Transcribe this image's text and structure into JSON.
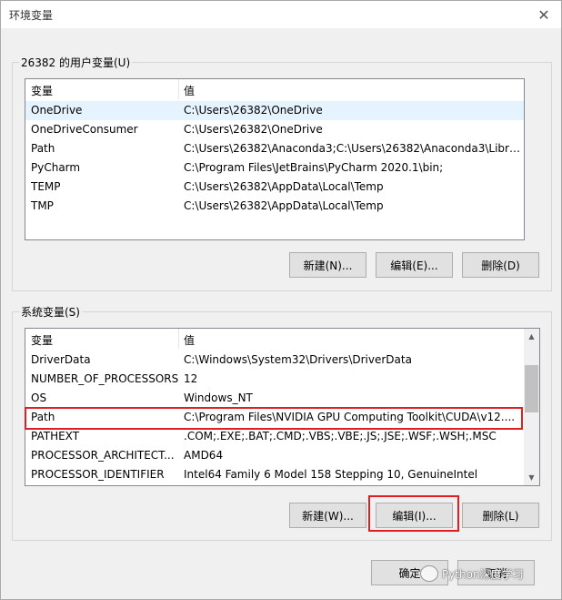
{
  "window": {
    "title": "环境变量",
    "close_glyph": "✕"
  },
  "user_vars": {
    "group_label": "26382 的用户变量(U)",
    "col_name": "变量",
    "col_value": "值",
    "rows": [
      {
        "name": "OneDrive",
        "value": "C:\\Users\\26382\\OneDrive"
      },
      {
        "name": "OneDriveConsumer",
        "value": "C:\\Users\\26382\\OneDrive"
      },
      {
        "name": "Path",
        "value": "C:\\Users\\26382\\Anaconda3;C:\\Users\\26382\\Anaconda3\\Libra..."
      },
      {
        "name": "PyCharm",
        "value": "C:\\Program Files\\JetBrains\\PyCharm 2020.1\\bin;"
      },
      {
        "name": "TEMP",
        "value": "C:\\Users\\26382\\AppData\\Local\\Temp"
      },
      {
        "name": "TMP",
        "value": "C:\\Users\\26382\\AppData\\Local\\Temp"
      }
    ],
    "buttons": {
      "new": "新建(N)...",
      "edit": "编辑(E)...",
      "delete": "删除(D)"
    }
  },
  "system_vars": {
    "group_label": "系统变量(S)",
    "col_name": "变量",
    "col_value": "值",
    "rows": [
      {
        "name": "DriverData",
        "value": "C:\\Windows\\System32\\Drivers\\DriverData"
      },
      {
        "name": "NUMBER_OF_PROCESSORS",
        "value": "12"
      },
      {
        "name": "OS",
        "value": "Windows_NT"
      },
      {
        "name": "Path",
        "value": "C:\\Program Files\\NVIDIA GPU Computing Toolkit\\CUDA\\v12...."
      },
      {
        "name": "PATHEXT",
        "value": ".COM;.EXE;.BAT;.CMD;.VBS;.VBE;.JS;.JSE;.WSF;.WSH;.MSC"
      },
      {
        "name": "PROCESSOR_ARCHITECT...",
        "value": "AMD64"
      },
      {
        "name": "PROCESSOR_IDENTIFIER",
        "value": "Intel64 Family 6 Model 158 Stepping 10, GenuineIntel"
      }
    ],
    "buttons": {
      "new": "新建(W)...",
      "edit": "编辑(I)...",
      "delete": "删除(L)"
    }
  },
  "footer": {
    "ok": "确定",
    "cancel": "取消"
  },
  "watermark": "Python深度学习",
  "colors": {
    "highlight": "#e02020",
    "selection": "#e5f3ff"
  }
}
